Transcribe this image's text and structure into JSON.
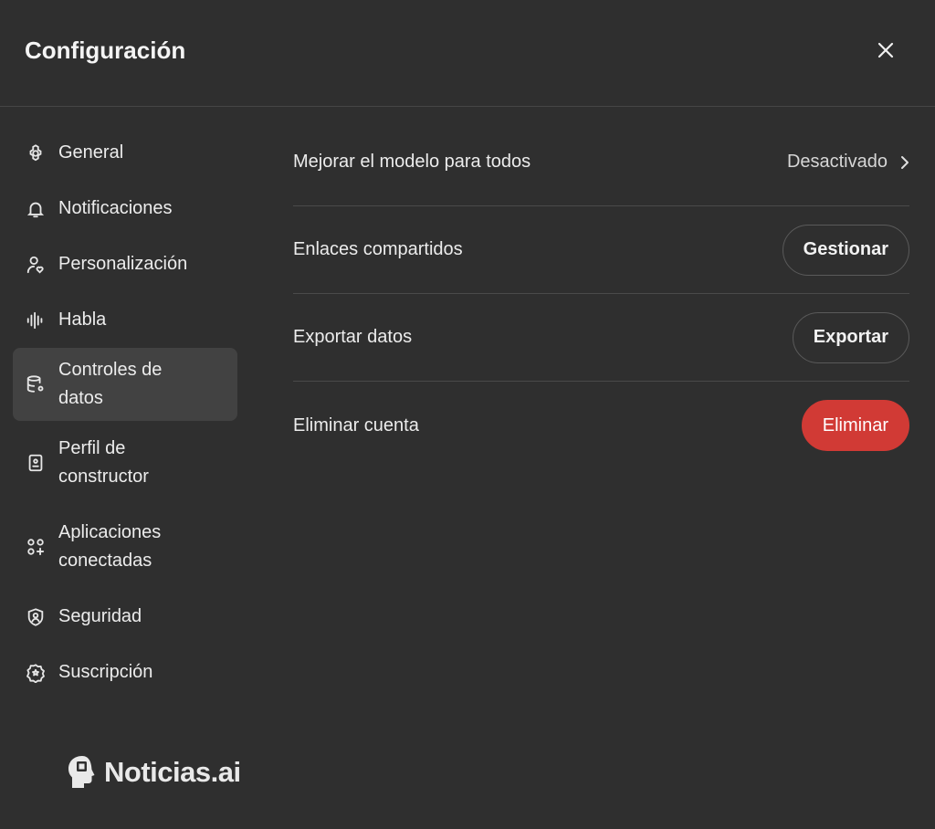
{
  "header": {
    "title": "Configuración"
  },
  "sidebar": {
    "items": [
      {
        "label": "General",
        "icon": "gear-icon"
      },
      {
        "label": "Notificaciones",
        "icon": "bell-icon"
      },
      {
        "label": "Personalización",
        "icon": "user-heart-icon"
      },
      {
        "label": "Habla",
        "icon": "waveform-icon"
      },
      {
        "label": "Controles de\ndatos",
        "icon": "database-gear-icon",
        "active": true
      },
      {
        "label": "Perfil de\nconstructor",
        "icon": "id-badge-icon"
      },
      {
        "label": "Aplicaciones\nconectadas",
        "icon": "apps-plus-icon"
      },
      {
        "label": "Seguridad",
        "icon": "shield-user-icon"
      },
      {
        "label": "Suscripción",
        "icon": "star-badge-icon"
      }
    ]
  },
  "main": {
    "rows": [
      {
        "label": "Mejorar el modelo para todos",
        "value": "Desactivado"
      },
      {
        "label": "Enlaces compartidos",
        "button": "Gestionar"
      },
      {
        "label": "Exportar datos",
        "button": "Exportar"
      },
      {
        "label": "Eliminar cuenta",
        "button": "Eliminar"
      }
    ]
  },
  "watermark": {
    "text": "Noticias.ai",
    "icon": "robot-head-icon"
  },
  "colors": {
    "background": "#2f2f2f",
    "danger": "#d13a35",
    "active_item": "#424242"
  }
}
